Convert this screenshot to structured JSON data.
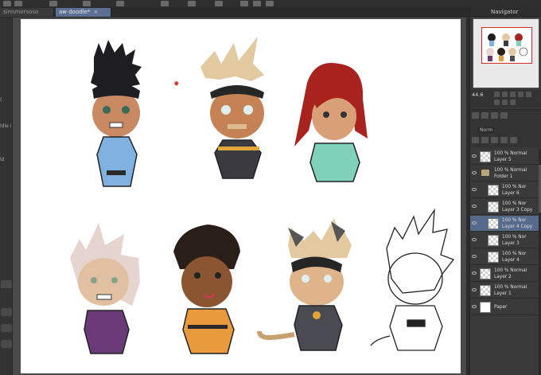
{
  "tabs": [
    {
      "label": "sinnmorsoso",
      "active": false
    },
    {
      "label": "aw doodle*",
      "active": true
    }
  ],
  "navigator": {
    "title": "Navigator",
    "zoom": "44.6"
  },
  "left_panel": {
    "labels": [
      "(",
      "ldle i",
      "ld"
    ]
  },
  "layer_props": {
    "blend": "Norm"
  },
  "layers": [
    {
      "opacity": "100 %",
      "mode": "Normal",
      "name": "Layer 5",
      "indent": 0,
      "type": "layer",
      "selected": false
    },
    {
      "opacity": "100 %",
      "mode": "Normal",
      "name": "Folder 1",
      "indent": 0,
      "type": "folder",
      "selected": false
    },
    {
      "opacity": "100 %",
      "mode": "Nor",
      "name": "Layer 6",
      "indent": 1,
      "type": "layer",
      "selected": false
    },
    {
      "opacity": "100 %",
      "mode": "Nor",
      "name": "Layer 3 Copy",
      "indent": 1,
      "type": "layer",
      "selected": false
    },
    {
      "opacity": "100 %",
      "mode": "Nor",
      "name": "Layer 4 Copy",
      "indent": 1,
      "type": "layer",
      "selected": true
    },
    {
      "opacity": "100 %",
      "mode": "Nor",
      "name": "Layer 3",
      "indent": 1,
      "type": "layer",
      "selected": false
    },
    {
      "opacity": "100 %",
      "mode": "Nor",
      "name": "Layer 4",
      "indent": 1,
      "type": "layer",
      "selected": false
    },
    {
      "opacity": "100 %",
      "mode": "Normal",
      "name": "Layer 2",
      "indent": 0,
      "type": "layer",
      "selected": false
    },
    {
      "opacity": "100 %",
      "mode": "Normal",
      "name": "Layer 1",
      "indent": 0,
      "type": "layer",
      "selected": false
    },
    {
      "opacity": "",
      "mode": "",
      "name": "Paper",
      "indent": 0,
      "type": "paper",
      "selected": false
    }
  ],
  "colors": {
    "accent": "#5b6f93",
    "selected_layer": "#566b8c",
    "nav_frame": "#d52b2b"
  }
}
